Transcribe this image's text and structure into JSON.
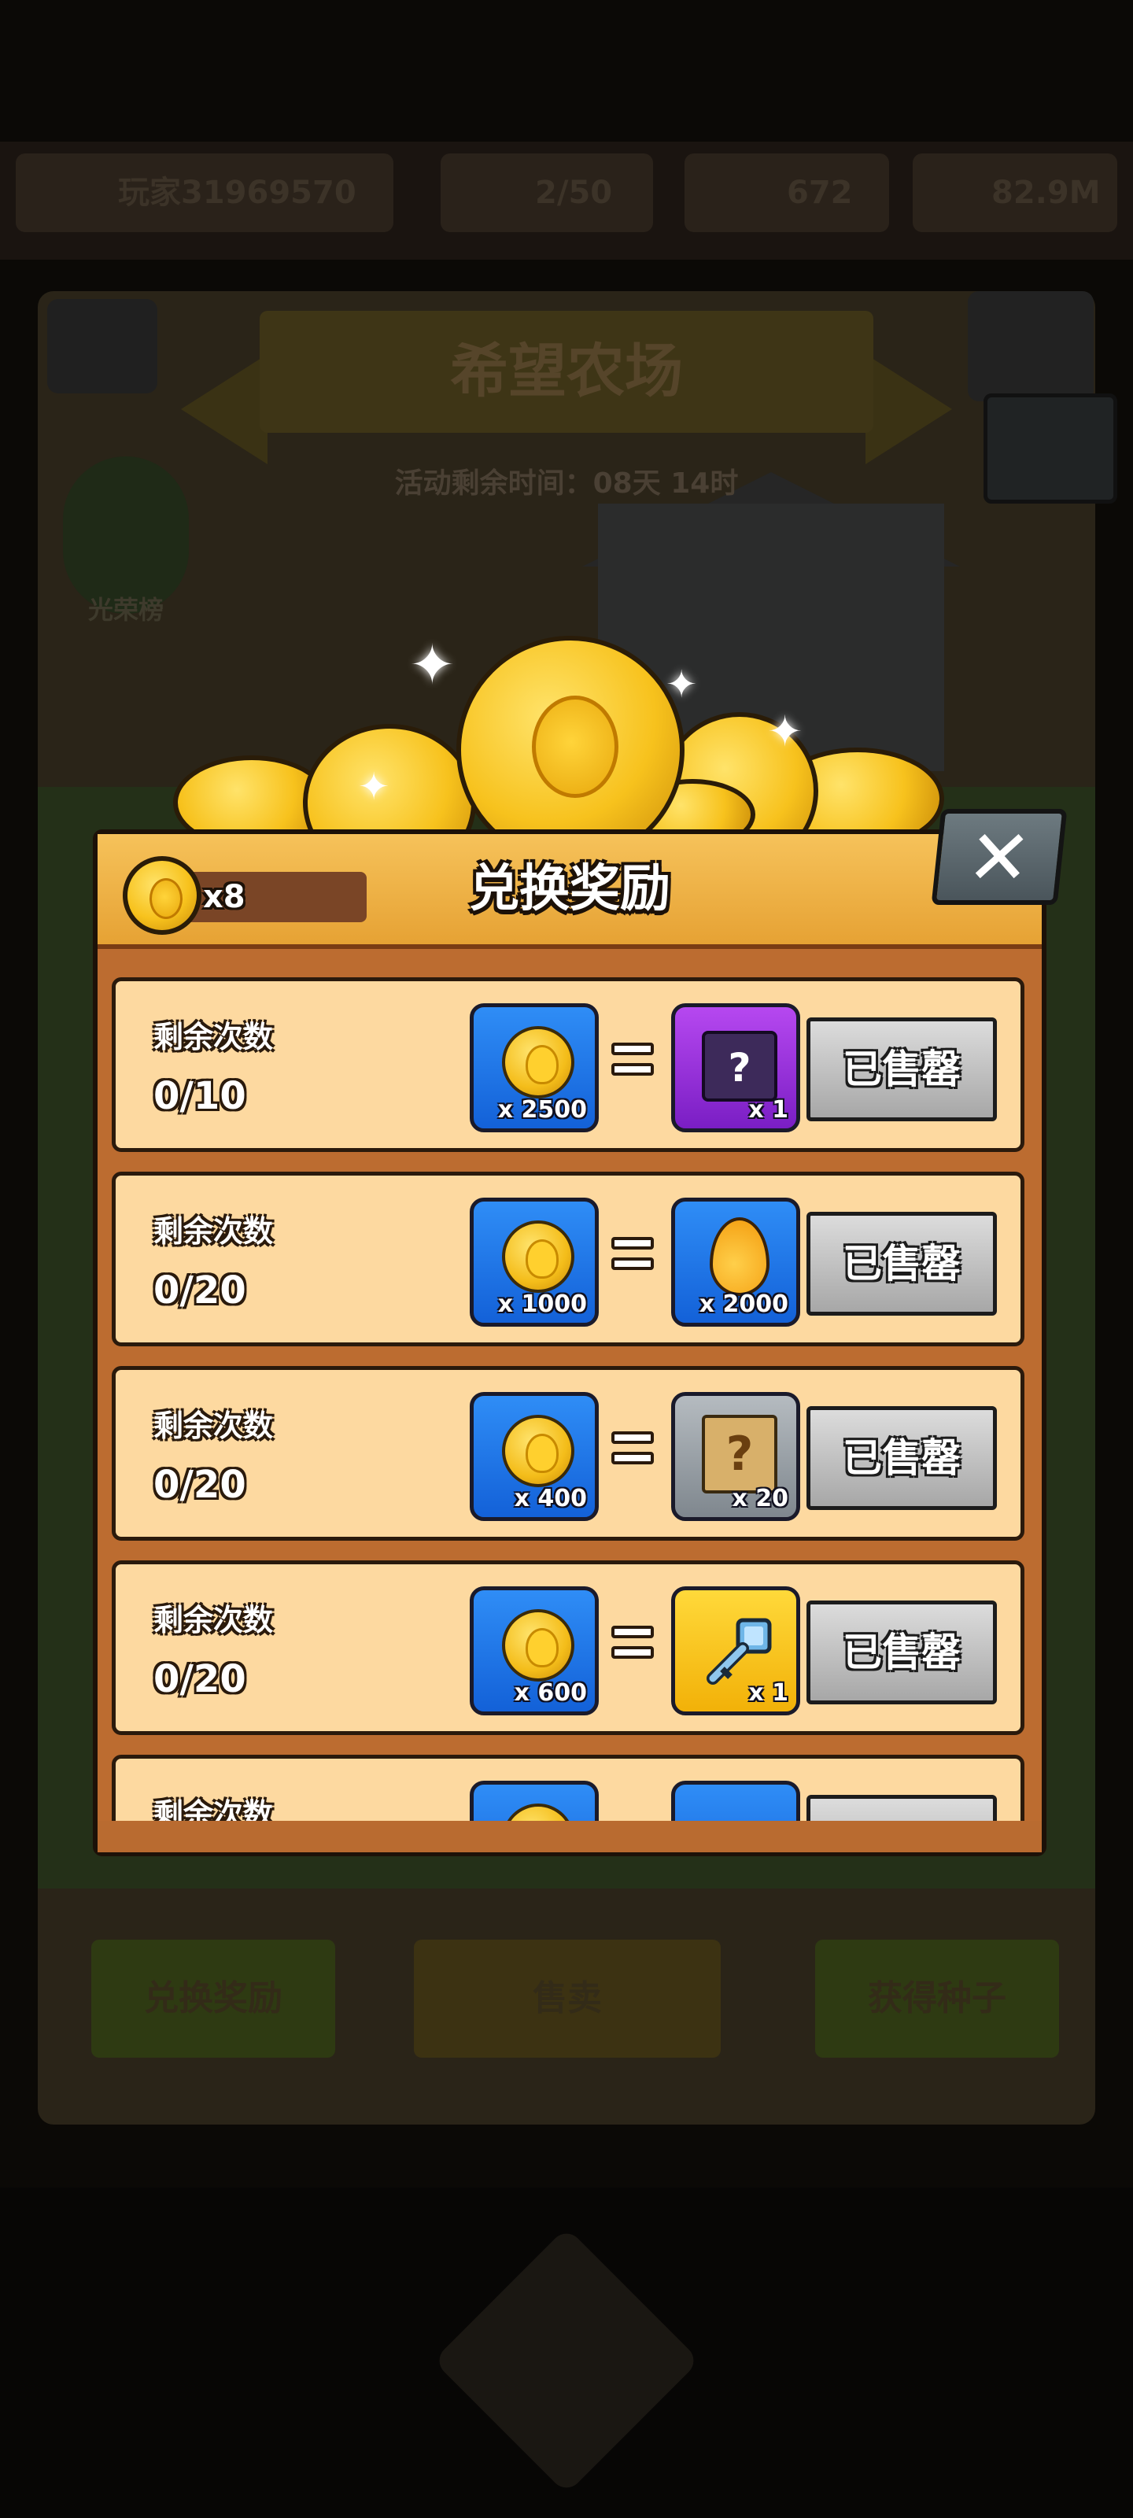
{
  "background": {
    "player_name": "玩家31969570",
    "energy": "2/50",
    "seeds": "672",
    "money": "82.9M",
    "event_title": "希望农场",
    "event_timer": "活动剩余时间：08天 14时",
    "glory_label": "光荣榜",
    "bottom_buttons": [
      "兑换奖励",
      "售卖",
      "获得种子"
    ]
  },
  "dialog": {
    "title": "兑换奖励",
    "currency_count": "x8",
    "rows": [
      {
        "label": "剩余次数",
        "count": "0/10",
        "cost_qty": "x 2500",
        "reward_icon": "mystery-chest",
        "reward_qty": "x 1",
        "button": "已售罄"
      },
      {
        "label": "剩余次数",
        "count": "0/20",
        "cost_qty": "x 1000",
        "reward_icon": "golden-drop",
        "reward_qty": "x 2000",
        "button": "已售罄"
      },
      {
        "label": "剩余次数",
        "count": "0/20",
        "cost_qty": "x 400",
        "reward_icon": "mystery-scroll",
        "reward_qty": "x 20",
        "button": "已售罄"
      },
      {
        "label": "剩余次数",
        "count": "0/20",
        "cost_qty": "x 600",
        "reward_icon": "key",
        "reward_qty": "x 1",
        "button": "已售罄"
      },
      {
        "label": "剩余次数"
      }
    ]
  },
  "colors": {
    "dialog_frame": "#bc6c30",
    "row_fill": "#fdd9a0",
    "cost_tile": "#2f8df6",
    "sold_button": "#c4c4c4"
  }
}
